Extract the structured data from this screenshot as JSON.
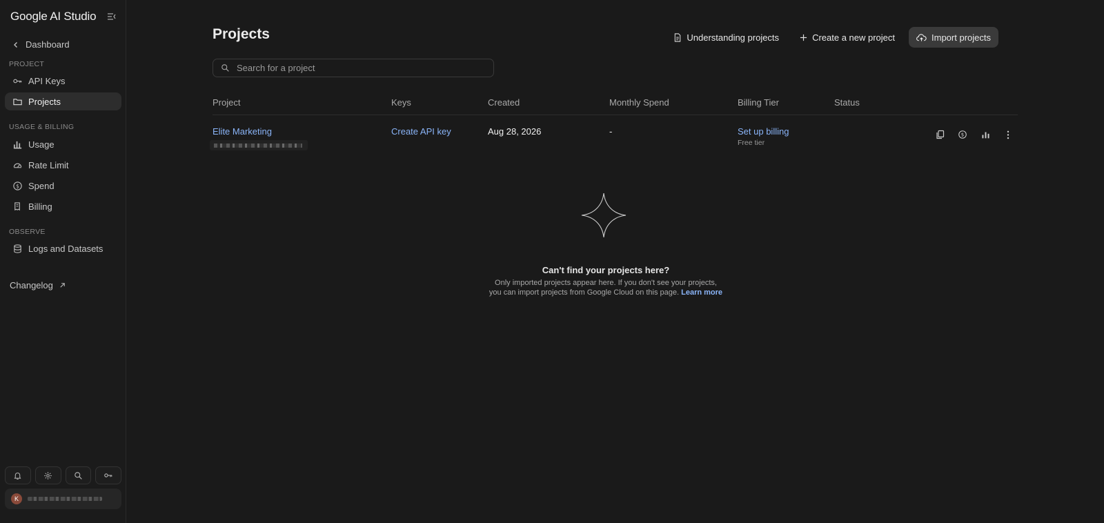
{
  "app": {
    "title": "Google AI Studio"
  },
  "sidebar": {
    "back_label": "Dashboard",
    "sections": {
      "project": "PROJECT",
      "usage_billing": "USAGE & BILLING",
      "observe": "OBSERVE"
    },
    "items": {
      "api_keys": "API Keys",
      "projects": "Projects",
      "usage": "Usage",
      "rate_limit": "Rate Limit",
      "spend": "Spend",
      "billing": "Billing",
      "logs": "Logs and Datasets"
    },
    "active_item": "Projects",
    "changelog": "Changelog",
    "account_initial": "K"
  },
  "main": {
    "title": "Projects",
    "actions": {
      "understanding": "Understanding projects",
      "create": "Create a new project",
      "import": "Import projects"
    },
    "search": {
      "placeholder": "Search for a project",
      "value": ""
    },
    "table": {
      "columns": [
        "Project",
        "Keys",
        "Created",
        "Monthly Spend",
        "Billing Tier",
        "Status"
      ],
      "rows": [
        {
          "project": "Elite Marketing",
          "keys": "Create API key",
          "created": "Aug 28, 2026",
          "spend": "-",
          "billing": "Set up billing",
          "tier": "Free tier",
          "status": ""
        }
      ]
    },
    "empty_state": {
      "title": "Can't find your projects here?",
      "line1": "Only imported projects appear here. If you don't see your projects,",
      "line2": "you can import projects from Google Cloud on this page.",
      "link": "Learn more"
    }
  },
  "colors": {
    "background": "#1a1a1a",
    "link": "#8ab4f8",
    "active_nav": "#2d2d2d"
  }
}
